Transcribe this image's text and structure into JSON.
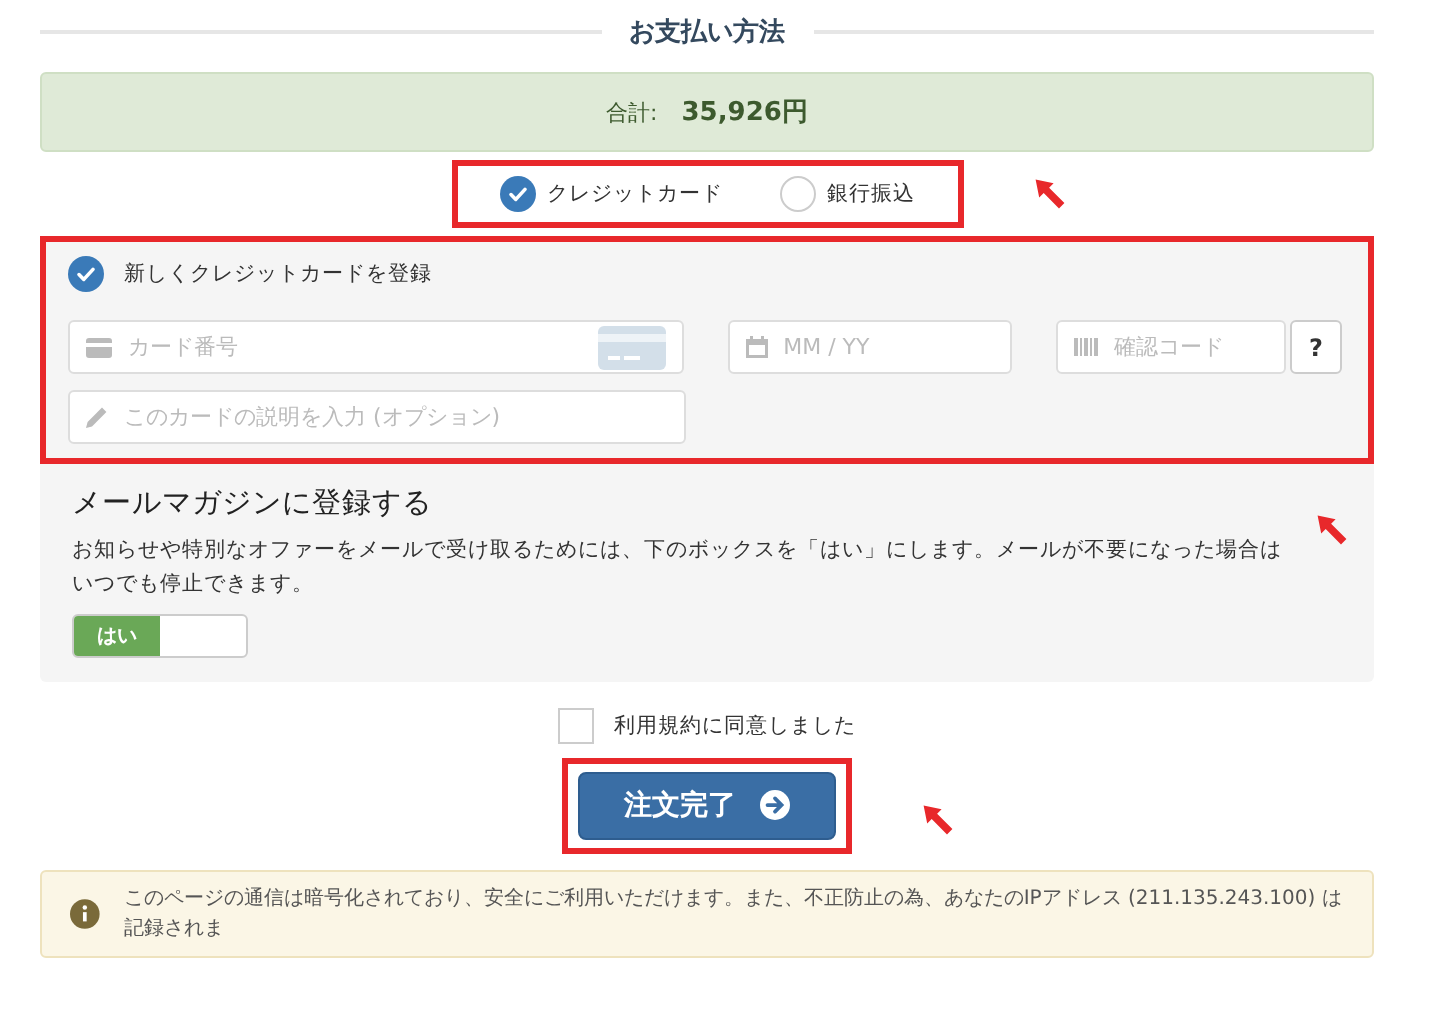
{
  "section_title": "お支払い方法",
  "total": {
    "label": "合計:",
    "amount": "35,926円"
  },
  "payment_methods": [
    {
      "label": "クレジットカード",
      "selected": true
    },
    {
      "label": "銀行振込",
      "selected": false
    }
  ],
  "card_form": {
    "register_new": {
      "label": "新しくクレジットカードを登録",
      "checked": true
    },
    "card_number": {
      "placeholder": "カード番号"
    },
    "expiry": {
      "placeholder": "MM / YY"
    },
    "cvc": {
      "placeholder": "確認コード"
    },
    "cvc_help": "?",
    "description": {
      "placeholder": "このカードの説明を入力 (オプション)"
    }
  },
  "newsletter": {
    "title": "メールマガジンに登録する",
    "text": "お知らせや特別なオファーをメールで受け取るためには、下のボックスを「はい」にします。メールが不要になった場合はいつでも停止できます。",
    "toggle": {
      "label": "はい",
      "on": true
    }
  },
  "terms": {
    "label": "利用規約に同意しました",
    "checked": false
  },
  "submit": "注文完了",
  "notice": "このページの通信は暗号化されており、安全にご利用いただけます。また、不正防止の為、あなたのIPアドレス (211.135.243.100) は記録されま"
}
